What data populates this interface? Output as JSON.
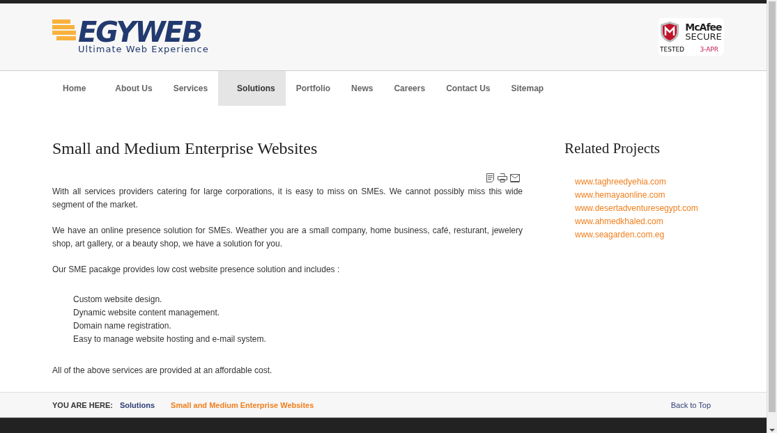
{
  "logo": {
    "name": "EGYWEB",
    "tagline": "Ultimate Web Experience"
  },
  "badge": {
    "brand": "McAfee",
    "word": "SECURE",
    "status": "TESTED",
    "date": "3-APR"
  },
  "nav": [
    {
      "label": "Home",
      "selected": false
    },
    {
      "label": "About Us",
      "selected": false
    },
    {
      "label": "Services",
      "selected": false
    },
    {
      "label": "Solutions",
      "selected": true
    },
    {
      "label": "Portfolio",
      "selected": false
    },
    {
      "label": "News",
      "selected": false
    },
    {
      "label": "Careers",
      "selected": false
    },
    {
      "label": "Contact Us",
      "selected": false
    },
    {
      "label": "Sitemap",
      "selected": false
    }
  ],
  "article": {
    "title": "Small and Medium Enterprise Websites",
    "paragraphs": [
      "With all services providers catering for large corporations, it is easy to miss on SMEs. We cannot possibly miss this wide segment of the market.",
      "We have an online presence solution for SMEs. Weather you are a small company, home business, café, resturant, jewelery shop, art gallery, or a beauty shop, we have a solution for you.",
      "Our SME pacakge provides low cost website presence solution and includes :"
    ],
    "list": [
      "Custom website design.",
      "Dynamic website content management.",
      "Domain name registration.",
      "Easy to manage website hosting and e-mail system."
    ],
    "closing": "All of the above services are provided at an affordable cost."
  },
  "related": {
    "title": "Related Projects",
    "links": [
      "www.taghreedyehia.com",
      "www.hemayaonline.com",
      "www.desertadventuresegypt.com",
      "www.ahmedkhaled.com",
      "www.seagarden.com.eg"
    ]
  },
  "breadcrumb": {
    "label": "YOU ARE HERE:",
    "items": [
      "Solutions",
      "Small and Medium Enterprise Websites"
    ],
    "back": "Back to Top"
  }
}
